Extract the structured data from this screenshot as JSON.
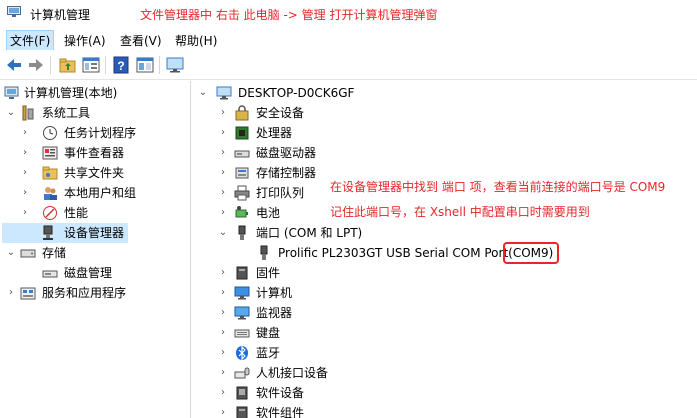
{
  "window": {
    "title": "计算机管理"
  },
  "annotation_top": "文件管理器中 右击 此电脑 -> 管理 打开计算机管理弹窗",
  "menu": [
    "文件(F)",
    "操作(A)",
    "查看(V)",
    "帮助(H)"
  ],
  "left_tree": {
    "root": "计算机管理(本地)",
    "system_tools": "系统工具",
    "task_scheduler": "任务计划程序",
    "event_viewer": "事件查看器",
    "shared_folders": "共享文件夹",
    "local_users": "本地用户和组",
    "performance": "性能",
    "device_manager": "设备管理器",
    "storage": "存储",
    "disk_management": "磁盘管理",
    "services_apps": "服务和应用程序"
  },
  "device_tree": {
    "computer": "DESKTOP-D0CK6GF",
    "security_devices": "安全设备",
    "processors": "处理器",
    "disk_drives": "磁盘驱动器",
    "storage_controllers": "存储控制器",
    "print_queues": "打印队列",
    "battery": "电池",
    "ports": "端口 (COM 和 LPT)",
    "prolific_device": "Prolific PL2303GT USB Serial COM Port",
    "com_port": "(COM9)",
    "firmware": "固件",
    "computer_cat": "计算机",
    "monitors": "监视器",
    "keyboards": "键盘",
    "bluetooth": "蓝牙",
    "hid": "人机接口设备",
    "software_devices": "软件设备",
    "software_components": "软件组件"
  },
  "annotation_right_1": "在设备管理器中找到 端口 项，查看当前连接的端口号是 COM9",
  "annotation_right_2": "记住此端口号，在 Xshell 中配置串口时需要用到"
}
